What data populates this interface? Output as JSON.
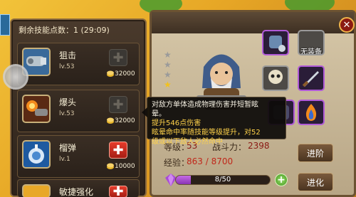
{
  "skill_panel": {
    "points_label": "剩余技能点数：",
    "points_value": "1 (29:09)",
    "skills": [
      {
        "name": "狙击",
        "level": "lv.53",
        "cost": "32000",
        "icon": "sniper-cannon-icon",
        "upgrade_enabled": false
      },
      {
        "name": "爆头",
        "level": "lv.53",
        "cost": "32000",
        "icon": "headshot-blast-icon",
        "upgrade_enabled": false
      },
      {
        "name": "榴弹",
        "level": "lv.1",
        "cost": "10000",
        "icon": "grenade-icon",
        "upgrade_enabled": true
      },
      {
        "name": "敏捷强化",
        "level": "",
        "cost": "",
        "icon": "agility-icon",
        "upgrade_enabled": true
      }
    ]
  },
  "tooltip": {
    "line1": "对敌方单体造成物理伤害并短暂眩",
    "line2": "晕。",
    "line3": "提升546点伤害",
    "line4": "眩晕命中率随技能等级提升，对52",
    "line5": "级或以下敌人必然命中"
  },
  "hero": {
    "stars": 4,
    "equipment": [
      {
        "label": "",
        "icon": "helmet-icon",
        "color": "purple"
      },
      {
        "label": "无装备",
        "icon": "empty-equipment-icon",
        "color": "grey"
      },
      {
        "label": "",
        "icon": "skull-icon",
        "color": "grey"
      },
      {
        "label": "",
        "icon": "sword-icon",
        "color": "purple"
      },
      {
        "label": "",
        "icon": "armor-icon",
        "color": "purple"
      },
      {
        "label": "",
        "icon": "flame-icon",
        "color": "purple"
      }
    ],
    "level_label": "等级：",
    "level_value": "53",
    "power_label": "战斗力：",
    "power_value": "2398",
    "exp_label": "经验：",
    "exp_value": "863 / 8700",
    "shards_text": "8/50",
    "shards_fraction": 0.16,
    "advance_button": "进阶",
    "evolve_button": "进化"
  },
  "colors": {
    "accent_red": "#c0271a",
    "level_color": "#8a1a14",
    "power_color": "#8a1a14",
    "exp_color": "#c0271a"
  }
}
